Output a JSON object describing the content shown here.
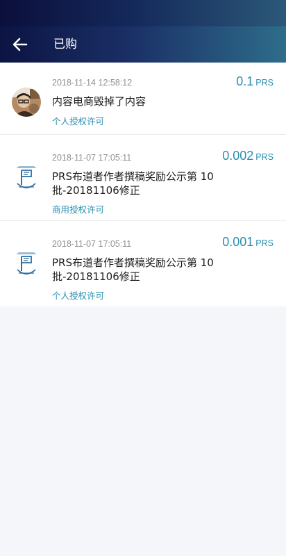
{
  "header": {
    "title": "已购",
    "back_icon": "arrow-left-icon"
  },
  "colors": {
    "header_start": "#0c1442",
    "header_end": "#2e6d8a",
    "accent": "#2a8fb0",
    "background": "#f4f6f9"
  },
  "purchases": [
    {
      "time": "2018-11-14 12:58:12",
      "amount": "0.1",
      "unit": "PRS",
      "title": "内容电商毁掉了内容",
      "license": "个人授权许可",
      "avatar": "person-photo-avatar"
    },
    {
      "time": "2018-11-07 17:05:11",
      "amount": "0.002",
      "unit": "PRS",
      "title": "PRS布道者作者撰稿奖励公示第 10 批-20181106修正",
      "license": "商用授权许可",
      "avatar": "logo-avatar"
    },
    {
      "time": "2018-11-07 17:05:11",
      "amount": "0.001",
      "unit": "PRS",
      "title": "PRS布道者作者撰稿奖励公示第 10 批-20181106修正",
      "license": "个人授权许可",
      "avatar": "logo-avatar"
    }
  ]
}
